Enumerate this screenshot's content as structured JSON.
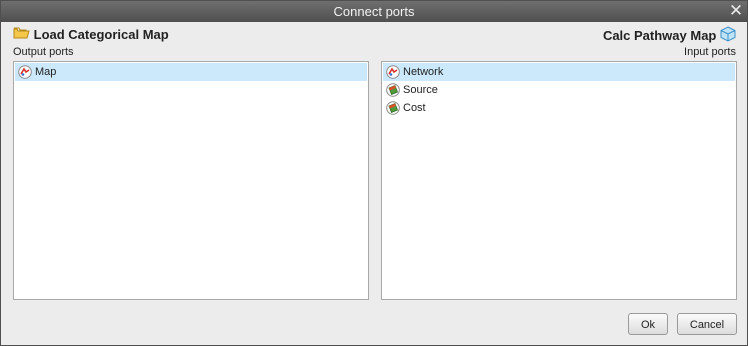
{
  "window": {
    "title": "Connect ports",
    "close_glyph": "✕"
  },
  "source": {
    "node_name": "Load Categorical Map",
    "node_icon": "folder-icon",
    "caption": "Output ports",
    "ports": [
      {
        "label": "Map",
        "icon": "map-port-icon",
        "selected": true
      }
    ]
  },
  "target": {
    "node_name": "Calc Pathway Map",
    "node_icon": "cube-icon",
    "caption": "Input ports",
    "ports": [
      {
        "label": "Network",
        "icon": "map-port-icon",
        "selected": true
      },
      {
        "label": "Source",
        "icon": "raster-port-icon",
        "selected": false
      },
      {
        "label": "Cost",
        "icon": "raster-port-icon",
        "selected": false
      }
    ]
  },
  "buttons": {
    "ok": "Ok",
    "cancel": "Cancel"
  },
  "colors": {
    "titlebar": "#5a5a5a",
    "selection": "#cbe9fb",
    "background": "#ececec"
  }
}
